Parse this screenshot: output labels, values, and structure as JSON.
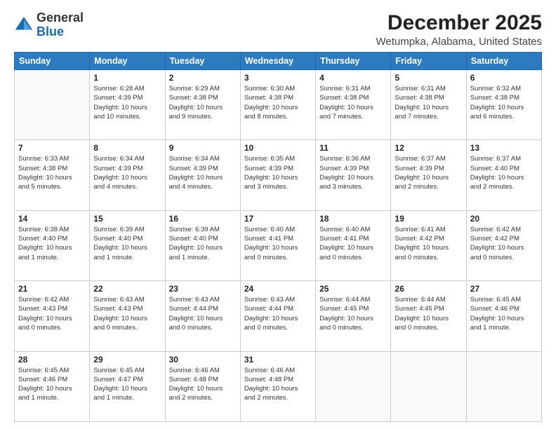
{
  "logo": {
    "general": "General",
    "blue": "Blue"
  },
  "title": "December 2025",
  "subtitle": "Wetumpka, Alabama, United States",
  "days_of_week": [
    "Sunday",
    "Monday",
    "Tuesday",
    "Wednesday",
    "Thursday",
    "Friday",
    "Saturday"
  ],
  "weeks": [
    [
      {
        "day": "",
        "info": ""
      },
      {
        "day": "1",
        "info": "Sunrise: 6:28 AM\nSunset: 4:39 PM\nDaylight: 10 hours\nand 10 minutes."
      },
      {
        "day": "2",
        "info": "Sunrise: 6:29 AM\nSunset: 4:38 PM\nDaylight: 10 hours\nand 9 minutes."
      },
      {
        "day": "3",
        "info": "Sunrise: 6:30 AM\nSunset: 4:38 PM\nDaylight: 10 hours\nand 8 minutes."
      },
      {
        "day": "4",
        "info": "Sunrise: 6:31 AM\nSunset: 4:38 PM\nDaylight: 10 hours\nand 7 minutes."
      },
      {
        "day": "5",
        "info": "Sunrise: 6:31 AM\nSunset: 4:38 PM\nDaylight: 10 hours\nand 7 minutes."
      },
      {
        "day": "6",
        "info": "Sunrise: 6:32 AM\nSunset: 4:38 PM\nDaylight: 10 hours\nand 6 minutes."
      }
    ],
    [
      {
        "day": "7",
        "info": "Sunrise: 6:33 AM\nSunset: 4:38 PM\nDaylight: 10 hours\nand 5 minutes."
      },
      {
        "day": "8",
        "info": "Sunrise: 6:34 AM\nSunset: 4:39 PM\nDaylight: 10 hours\nand 4 minutes."
      },
      {
        "day": "9",
        "info": "Sunrise: 6:34 AM\nSunset: 4:39 PM\nDaylight: 10 hours\nand 4 minutes."
      },
      {
        "day": "10",
        "info": "Sunrise: 6:35 AM\nSunset: 4:39 PM\nDaylight: 10 hours\nand 3 minutes."
      },
      {
        "day": "11",
        "info": "Sunrise: 6:36 AM\nSunset: 4:39 PM\nDaylight: 10 hours\nand 3 minutes."
      },
      {
        "day": "12",
        "info": "Sunrise: 6:37 AM\nSunset: 4:39 PM\nDaylight: 10 hours\nand 2 minutes."
      },
      {
        "day": "13",
        "info": "Sunrise: 6:37 AM\nSunset: 4:40 PM\nDaylight: 10 hours\nand 2 minutes."
      }
    ],
    [
      {
        "day": "14",
        "info": "Sunrise: 6:38 AM\nSunset: 4:40 PM\nDaylight: 10 hours\nand 1 minute."
      },
      {
        "day": "15",
        "info": "Sunrise: 6:39 AM\nSunset: 4:40 PM\nDaylight: 10 hours\nand 1 minute."
      },
      {
        "day": "16",
        "info": "Sunrise: 6:39 AM\nSunset: 4:40 PM\nDaylight: 10 hours\nand 1 minute."
      },
      {
        "day": "17",
        "info": "Sunrise: 6:40 AM\nSunset: 4:41 PM\nDaylight: 10 hours\nand 0 minutes."
      },
      {
        "day": "18",
        "info": "Sunrise: 6:40 AM\nSunset: 4:41 PM\nDaylight: 10 hours\nand 0 minutes."
      },
      {
        "day": "19",
        "info": "Sunrise: 6:41 AM\nSunset: 4:42 PM\nDaylight: 10 hours\nand 0 minutes."
      },
      {
        "day": "20",
        "info": "Sunrise: 6:42 AM\nSunset: 4:42 PM\nDaylight: 10 hours\nand 0 minutes."
      }
    ],
    [
      {
        "day": "21",
        "info": "Sunrise: 6:42 AM\nSunset: 4:43 PM\nDaylight: 10 hours\nand 0 minutes."
      },
      {
        "day": "22",
        "info": "Sunrise: 6:43 AM\nSunset: 4:43 PM\nDaylight: 10 hours\nand 0 minutes."
      },
      {
        "day": "23",
        "info": "Sunrise: 6:43 AM\nSunset: 4:44 PM\nDaylight: 10 hours\nand 0 minutes."
      },
      {
        "day": "24",
        "info": "Sunrise: 6:43 AM\nSunset: 4:44 PM\nDaylight: 10 hours\nand 0 minutes."
      },
      {
        "day": "25",
        "info": "Sunrise: 6:44 AM\nSunset: 4:45 PM\nDaylight: 10 hours\nand 0 minutes."
      },
      {
        "day": "26",
        "info": "Sunrise: 6:44 AM\nSunset: 4:45 PM\nDaylight: 10 hours\nand 0 minutes."
      },
      {
        "day": "27",
        "info": "Sunrise: 6:45 AM\nSunset: 4:46 PM\nDaylight: 10 hours\nand 1 minute."
      }
    ],
    [
      {
        "day": "28",
        "info": "Sunrise: 6:45 AM\nSunset: 4:46 PM\nDaylight: 10 hours\nand 1 minute."
      },
      {
        "day": "29",
        "info": "Sunrise: 6:45 AM\nSunset: 4:47 PM\nDaylight: 10 hours\nand 1 minute."
      },
      {
        "day": "30",
        "info": "Sunrise: 6:46 AM\nSunset: 4:48 PM\nDaylight: 10 hours\nand 2 minutes."
      },
      {
        "day": "31",
        "info": "Sunrise: 6:46 AM\nSunset: 4:48 PM\nDaylight: 10 hours\nand 2 minutes."
      },
      {
        "day": "",
        "info": ""
      },
      {
        "day": "",
        "info": ""
      },
      {
        "day": "",
        "info": ""
      }
    ]
  ]
}
